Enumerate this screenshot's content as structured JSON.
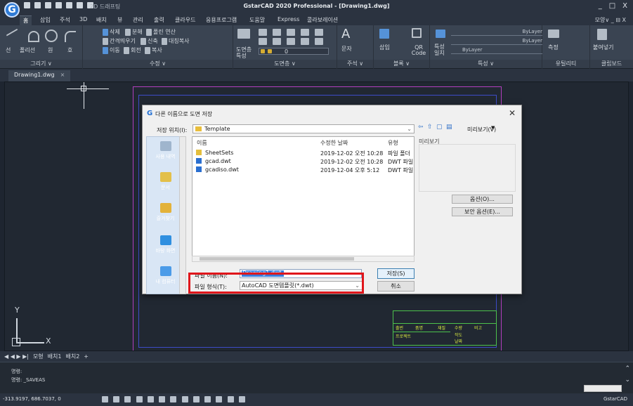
{
  "app": {
    "title": "GstarCAD 2020 Professional - [Drawing1.dwg]",
    "logo_letter": "G",
    "workspace": "2D 드래프팅"
  },
  "ribbon_tabs": [
    "홈",
    "삽입",
    "주석",
    "3D",
    "배치",
    "뷰",
    "관리",
    "출력",
    "클라우드",
    "응용프로그램",
    "도움말",
    "Express",
    "콜라보레이션"
  ],
  "ribbon_right": "모양∨ _ ⊟ X",
  "ribbon_panels": {
    "draw": {
      "label": "그리기 ∨",
      "items": [
        "선",
        "폴리선",
        "원",
        "호"
      ]
    },
    "modify": {
      "label": "수정 ∨",
      "items": [
        "삭제",
        "분해",
        "폴린 연산",
        "간격띄우기",
        "신축",
        "대칭복사",
        "이동",
        "회전",
        "복사"
      ]
    },
    "layers": {
      "label": "도면층 ∨",
      "items": [
        "도면층 특성",
        "0"
      ]
    },
    "annotation": {
      "label": "주석 ∨",
      "items": [
        "문자"
      ]
    },
    "block": {
      "label": "블록 ∨",
      "items": [
        "삽입",
        "QR Code"
      ]
    },
    "properties": {
      "label": "특성 ∨",
      "items": [
        "특성 일치",
        "ByLayer",
        "ByLayer",
        "ByLayer"
      ]
    },
    "utilities": {
      "label": "유틸리티",
      "items": [
        "측정"
      ]
    },
    "clipboard": {
      "label": "클립보드",
      "items": [
        "붙여넣기"
      ]
    }
  },
  "doc_tab": {
    "label": "Drawing1.dwg",
    "close": "×"
  },
  "layout_tabs": [
    "모형",
    "배치1",
    "배치2"
  ],
  "command_lines": [
    "명령:",
    "명령: _SAVEAS"
  ],
  "status": {
    "coords": "-313.9197, 686.7037, 0",
    "app_name": "GstarCAD"
  },
  "dialog": {
    "title": "다른 이름으로 도면 저장",
    "save_in_label": "저장 위치(I):",
    "save_in_value": "Template",
    "preview_menu": "미리보기(V)",
    "preview_title": "미리보기",
    "options_button": "옵션(O)...",
    "security_button": "보안 옵션(E)...",
    "places": [
      "사용 내역",
      "문서",
      "즐겨찾기",
      "바탕 화면",
      "내 컴퓨터"
    ],
    "columns": [
      "이름",
      "수정한 날짜",
      "유형"
    ],
    "files": [
      {
        "name": "SheetSets",
        "date": "2019-12-02 오전 10:28",
        "type": "파일 폴더"
      },
      {
        "name": "gcad.dwt",
        "date": "2019-12-02 오전 10:28",
        "type": "DWT 파일"
      },
      {
        "name": "gcadiso.dwt",
        "date": "2019-12-04 오후 5:12",
        "type": "DWT 파일"
      }
    ],
    "file_name_label": "파일 이름(N):",
    "file_name_value": "Drawing1.dwt",
    "file_type_label": "파일 형식(T):",
    "file_type_value": "AutoCAD 도면템플릿(*.dwt)",
    "save_button": "저장(S)",
    "cancel_button": "취소"
  },
  "title_block": {
    "cells": [
      "출번",
      "품명",
      "재질",
      "수량",
      "비고",
      "프로젝트",
      "작도",
      "날짜"
    ]
  },
  "ucs": {
    "x": "X",
    "y": "Y"
  },
  "colors": {
    "accent": "#2f7bd6",
    "highlight": "#e0161b",
    "border_magenta": "#b23fbf",
    "title_block": "#4cc24c"
  }
}
